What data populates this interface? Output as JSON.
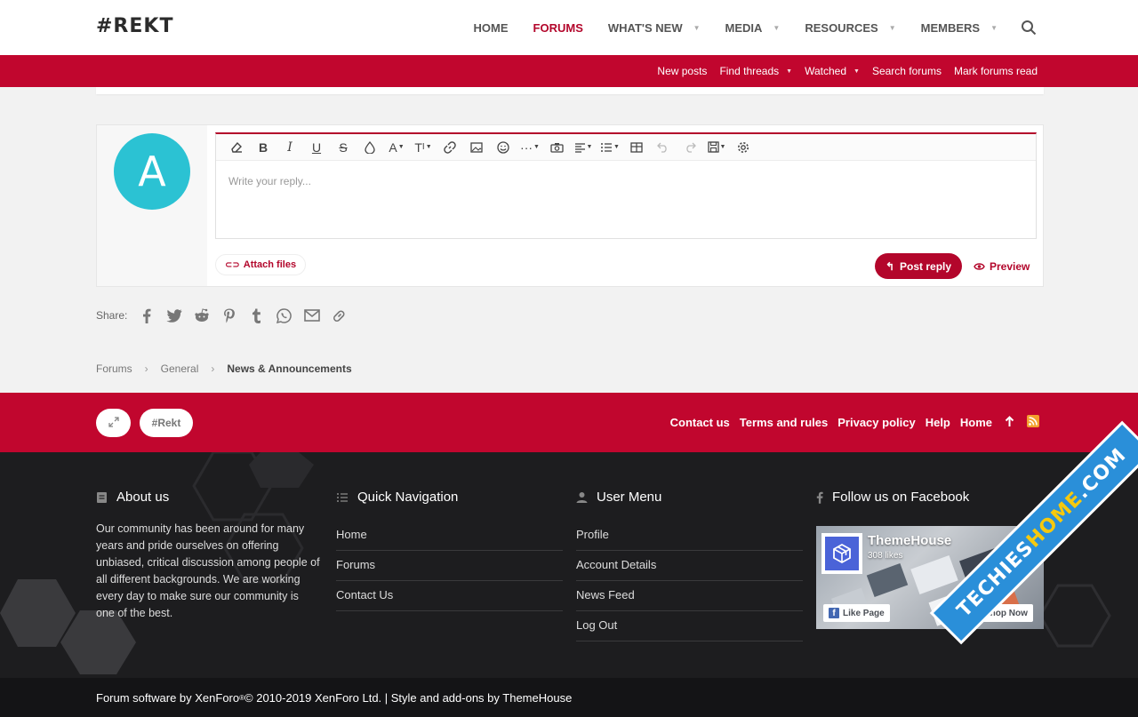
{
  "header": {
    "logo": "#REKT",
    "nav": [
      {
        "label": "HOME",
        "active": false,
        "caret": false
      },
      {
        "label": "FORUMS",
        "active": true,
        "caret": false
      },
      {
        "label": "WHAT'S NEW",
        "active": false,
        "caret": true
      },
      {
        "label": "MEDIA",
        "active": false,
        "caret": true
      },
      {
        "label": "RESOURCES",
        "active": false,
        "caret": true
      },
      {
        "label": "MEMBERS",
        "active": false,
        "caret": true
      }
    ],
    "search_icon": "search-icon"
  },
  "subnav": [
    {
      "label": "New posts",
      "caret": false
    },
    {
      "label": "Find threads",
      "caret": true
    },
    {
      "label": "Watched",
      "caret": true
    },
    {
      "label": "Search forums",
      "caret": false
    },
    {
      "label": "Mark forums read",
      "caret": false
    }
  ],
  "reply": {
    "avatar_letter": "A",
    "placeholder": "Write your reply...",
    "attach_label": "Attach files",
    "post_label": "Post reply",
    "preview_label": "Preview"
  },
  "share": {
    "label": "Share:",
    "icons": [
      "facebook-icon",
      "twitter-icon",
      "reddit-icon",
      "pinterest-icon",
      "tumblr-icon",
      "whatsapp-icon",
      "email-icon",
      "link-icon"
    ]
  },
  "breadcrumb": [
    "Forums",
    "General",
    "News & Announcements"
  ],
  "footer_bar": {
    "style_chooser": "#Rekt",
    "links": [
      "Contact us",
      "Terms and rules",
      "Privacy policy",
      "Help",
      "Home"
    ]
  },
  "footer": {
    "about": {
      "title": "About us",
      "text": "Our community has been around for many years and pride ourselves on offering unbiased, critical discussion among people of all different backgrounds. We are working every day to make sure our community is one of the best."
    },
    "quick_nav": {
      "title": "Quick Navigation",
      "links": [
        "Home",
        "Forums",
        "Contact Us"
      ]
    },
    "user_menu": {
      "title": "User Menu",
      "links": [
        "Profile",
        "Account Details",
        "News Feed",
        "Log Out"
      ]
    },
    "facebook": {
      "title": "Follow us on Facebook",
      "page_name": "ThemeHouse",
      "likes": "308 likes",
      "like_btn": "Like Page",
      "shop_btn": "Shop Now"
    }
  },
  "copyright": {
    "pre": "Forum software by XenForo",
    "reg": "®",
    "post": " © 2010-2019 XenForo Ltd. | Style and add-ons by ThemeHouse"
  },
  "watermark": {
    "part1": "TECHIES",
    "part2": "HOME",
    "part3": ".COM"
  },
  "colors": {
    "brand_red": "#c1062e",
    "accent_red": "#b3062b",
    "avatar": "#2bc2d3",
    "footer_dark": "#1d1d1f"
  }
}
